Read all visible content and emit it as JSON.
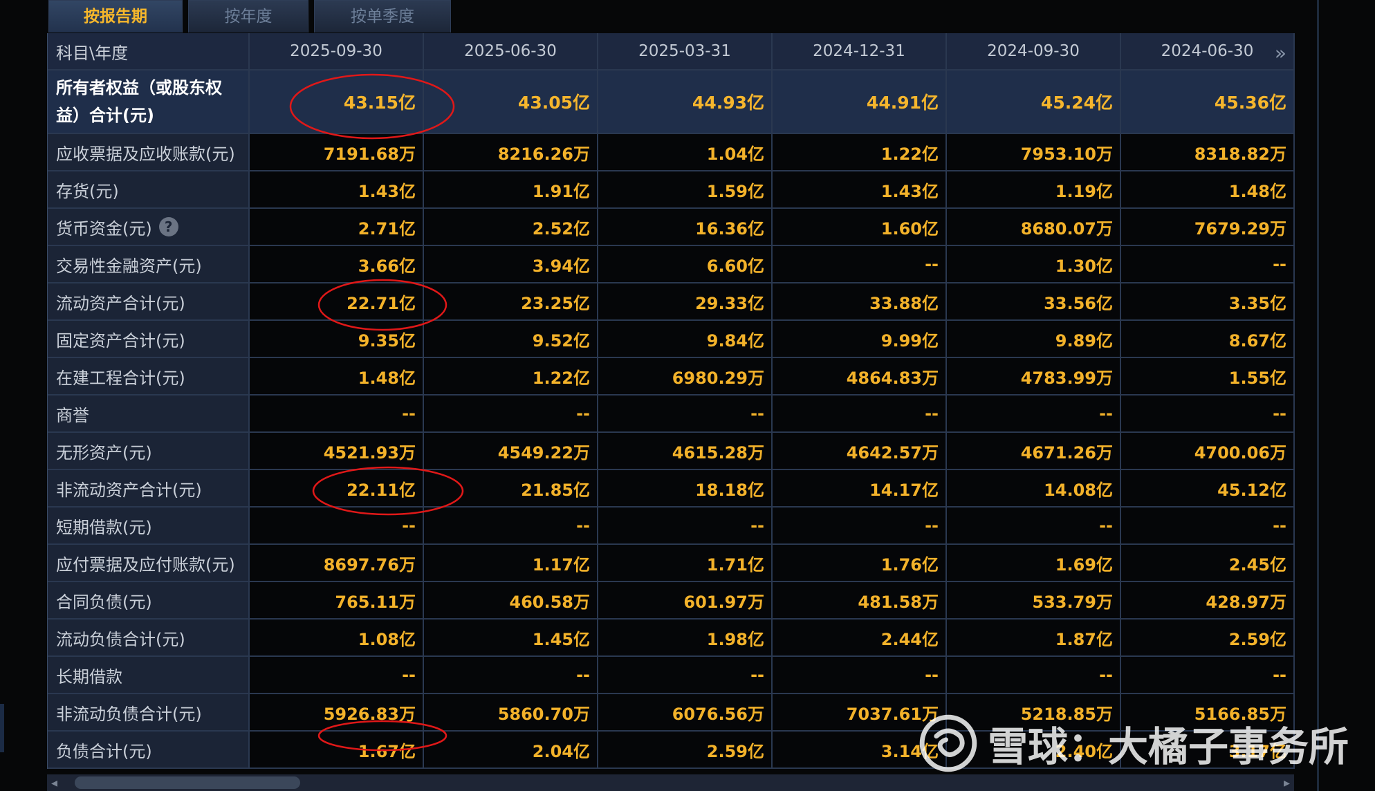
{
  "tabs": [
    "按报告期",
    "按年度",
    "按单季度"
  ],
  "table": {
    "corner": "科目\\年度",
    "columns": [
      "2025-09-30",
      "2025-06-30",
      "2025-03-31",
      "2024-12-31",
      "2024-09-30",
      "2024-06-30"
    ],
    "rows": [
      {
        "label": "所有者权益（或股东权益）合计(元)",
        "values": [
          "43.15亿",
          "43.05亿",
          "44.93亿",
          "44.91亿",
          "45.24亿",
          "45.36亿"
        ]
      },
      {
        "label": "应收票据及应收账款(元)",
        "values": [
          "7191.68万",
          "8216.26万",
          "1.04亿",
          "1.22亿",
          "7953.10万",
          "8318.82万"
        ]
      },
      {
        "label": "存货(元)",
        "values": [
          "1.43亿",
          "1.91亿",
          "1.59亿",
          "1.43亿",
          "1.19亿",
          "1.48亿"
        ]
      },
      {
        "label": "货币资金(元)",
        "values": [
          "2.71亿",
          "2.52亿",
          "16.36亿",
          "1.60亿",
          "8680.07万",
          "7679.29万"
        ]
      },
      {
        "label": "交易性金融资产(元)",
        "values": [
          "3.66亿",
          "3.94亿",
          "6.60亿",
          "--",
          "1.30亿",
          "--"
        ]
      },
      {
        "label": "流动资产合计(元)",
        "values": [
          "22.71亿",
          "23.25亿",
          "29.33亿",
          "33.88亿",
          "33.56亿",
          "3.35亿"
        ]
      },
      {
        "label": "固定资产合计(元)",
        "values": [
          "9.35亿",
          "9.52亿",
          "9.84亿",
          "9.99亿",
          "9.89亿",
          "8.67亿"
        ]
      },
      {
        "label": "在建工程合计(元)",
        "values": [
          "1.48亿",
          "1.22亿",
          "6980.29万",
          "4864.83万",
          "4783.99万",
          "1.55亿"
        ]
      },
      {
        "label": "商誉",
        "values": [
          "--",
          "--",
          "--",
          "--",
          "--",
          "--"
        ]
      },
      {
        "label": "无形资产(元)",
        "values": [
          "4521.93万",
          "4549.22万",
          "4615.28万",
          "4642.57万",
          "4671.26万",
          "4700.06万"
        ]
      },
      {
        "label": "非流动资产合计(元)",
        "values": [
          "22.11亿",
          "21.85亿",
          "18.18亿",
          "14.17亿",
          "14.08亿",
          "45.12亿"
        ]
      },
      {
        "label": "短期借款(元)",
        "values": [
          "--",
          "--",
          "--",
          "--",
          "--",
          "--"
        ]
      },
      {
        "label": "应付票据及应付账款(元)",
        "values": [
          "8697.76万",
          "1.17亿",
          "1.71亿",
          "1.76亿",
          "1.69亿",
          "2.45亿"
        ]
      },
      {
        "label": "合同负债(元)",
        "values": [
          "765.11万",
          "460.58万",
          "601.97万",
          "481.58万",
          "533.79万",
          "428.97万"
        ]
      },
      {
        "label": "流动负债合计(元)",
        "values": [
          "1.08亿",
          "1.45亿",
          "1.98亿",
          "2.44亿",
          "1.87亿",
          "2.59亿"
        ]
      },
      {
        "label": "长期借款",
        "values": [
          "--",
          "--",
          "--",
          "--",
          "--",
          "--"
        ]
      },
      {
        "label": "非流动负债合计(元)",
        "values": [
          "5926.83万",
          "5860.70万",
          "6076.56万",
          "7037.61万",
          "5218.85万",
          "5166.85万"
        ]
      },
      {
        "label": "负债合计(元)",
        "values": [
          "1.67亿",
          "2.04亿",
          "2.59亿",
          "3.14亿",
          "2.40亿",
          "3.17亿"
        ]
      }
    ]
  },
  "watermark": "雪球：大橘子事务所",
  "icons": {
    "help": "question-icon",
    "next": "double-chevron-right-icon"
  },
  "colors": {
    "value": "#f3b22a",
    "annotation": "#e01818"
  }
}
